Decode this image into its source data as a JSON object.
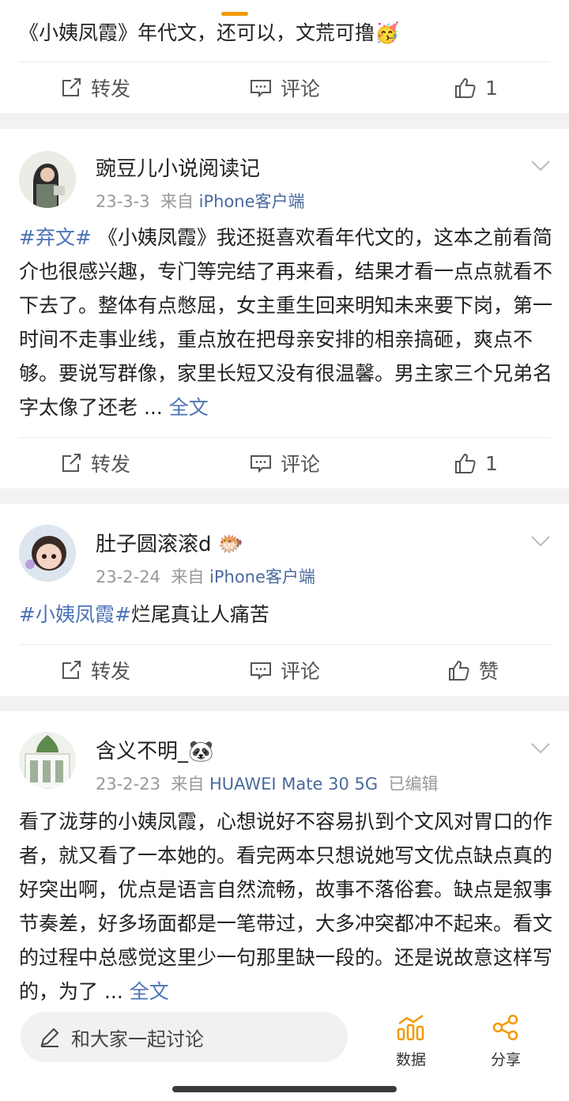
{
  "top_snippet": {
    "text": "《小姨凤霞》年代文，还可以，文荒可撸",
    "emoji": "🥳",
    "actions": {
      "repost": "转发",
      "comment": "评论",
      "like": "1"
    }
  },
  "posts": [
    {
      "username": "豌豆儿小说阅读记",
      "date": "23-3-3",
      "from_label": "来自",
      "source": "iPhone客户端",
      "tag": "#弃文#",
      "body": " 《小姨凤霞》我还挺喜欢看年代文的，这本之前看简介也很感兴趣，专门等完结了再来看，结果才看一点点就看不下去了。整体有点憋屈，女主重生回来明知未来要下岗，第一时间不走事业线，重点放在把母亲安排的相亲搞砸，爽点不够。要说写群像，家里长短又没有很温馨。男主家三个兄弟名字太像了还老 ...",
      "more": " 全文",
      "actions": {
        "repost": "转发",
        "comment": "评论",
        "like": "1"
      }
    },
    {
      "username": "肚子圆滚滚d",
      "username_emoji": "🐡",
      "date": "23-2-24",
      "from_label": "来自",
      "source": "iPhone客户端",
      "tag": "#小姨凤霞#",
      "body": "烂尾真让人痛苦",
      "actions": {
        "repost": "转发",
        "comment": "评论",
        "like": "赞"
      }
    },
    {
      "username": "含义不明_",
      "username_emoji": "🐼",
      "date": "23-2-23",
      "from_label": "来自",
      "source": "HUAWEI Mate 30 5G",
      "edited": "已编辑",
      "body": "看了泷芽的小姨凤霞，心想说好不容易扒到个文风对胃口的作者，就又看了一本她的。看完两本只想说她写文优点缺点真的好突出啊，优点是语言自然流畅，故事不落俗套。缺点是叙事节奏差，好多场面都是一笔带过，大多冲突都冲不起来。看文的过程中总感觉这里少一句那里缺一段的。还是说故意这样写的，为了 ...",
      "more": " 全文"
    }
  ],
  "bottom_bar": {
    "input_placeholder": "和大家一起讨论",
    "data_label": "数据",
    "share_label": "分享"
  },
  "colors": {
    "accent": "#f39800",
    "link": "#4b73b6"
  },
  "icons": [
    "repost-icon",
    "comment-icon",
    "like-icon",
    "chevron-down-icon",
    "pen-icon",
    "data-chart-icon",
    "share-icon"
  ]
}
